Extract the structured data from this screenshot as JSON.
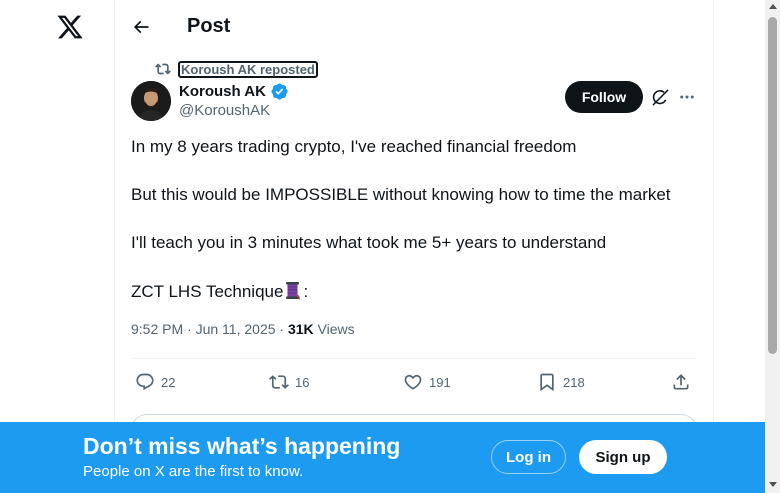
{
  "header": {
    "title": "Post",
    "back_icon": "arrow-left-icon",
    "logo_icon": "x-logo-icon"
  },
  "repost": {
    "text": "Koroush AK reposted",
    "icon": "repost-icon"
  },
  "author": {
    "name": "Koroush AK",
    "handle": "@KoroushAK",
    "verified": true,
    "verified_color": "#1d9bf0"
  },
  "follow": {
    "label": "Follow"
  },
  "tweet": {
    "line1": "In my 8 years trading crypto, I've reached financial freedom",
    "line2": "But this would be IMPOSSIBLE without knowing how to time the market",
    "line3": "I'll teach you in 3 minutes what took me 5+ years to understand",
    "line4_text": "ZCT LHS Technique",
    "line4_emoji": "thread-spool-emoji",
    "line4_suffix": ":"
  },
  "meta": {
    "time": "9:52 PM",
    "separator": "·",
    "date": "Jun 11, 2025",
    "views_count": "31K",
    "views_label": "Views"
  },
  "actions": {
    "replies": "22",
    "reposts": "16",
    "likes": "191",
    "bookmarks": "218"
  },
  "banner": {
    "title": "Don’t miss what’s happening",
    "subtitle": "People on X are the first to know.",
    "login_label": "Log in",
    "signup_label": "Sign up",
    "color": "#1d9bf0"
  }
}
